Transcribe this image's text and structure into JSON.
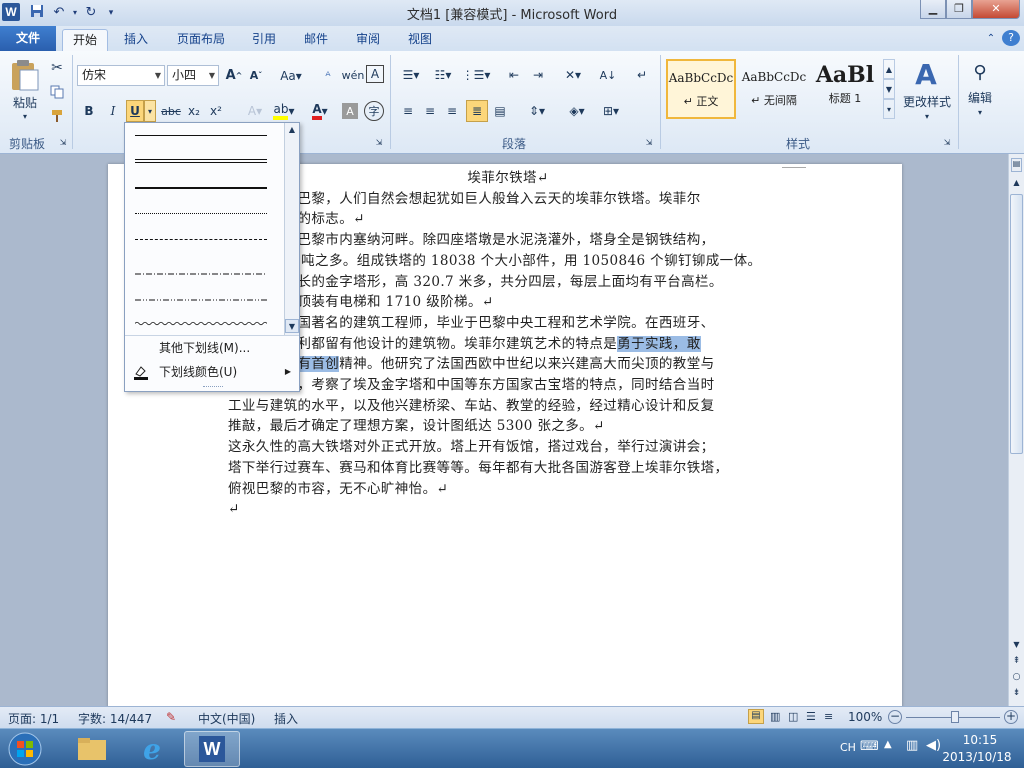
{
  "window": {
    "title": "文档1 [兼容模式] - Microsoft Word",
    "app_logo_letter": "W"
  },
  "ribbon_tabs": [
    "文件",
    "开始",
    "插入",
    "页面布局",
    "引用",
    "邮件",
    "审阅",
    "视图"
  ],
  "clipboard": {
    "paste_label": "粘贴",
    "group_label": "剪贴板"
  },
  "font": {
    "name": "仿宋",
    "size": "小四"
  },
  "paragraph": {
    "group_label": "段落"
  },
  "styles": {
    "group_label": "样式",
    "items": [
      {
        "preview": "AaBbCcDc",
        "name": "↵ 正文"
      },
      {
        "preview": "AaBbCcDc",
        "name": "↵ 无间隔"
      },
      {
        "preview": "AaBl",
        "name": "标题 1"
      }
    ],
    "change_styles_label": "更改样式"
  },
  "editing": {
    "label": "编辑"
  },
  "underline_menu": {
    "more_underlines": "其他下划线(M)...",
    "underline_color": "下划线颜色(U)"
  },
  "document": {
    "heading": "埃菲尔铁塔↵",
    "lines": [
      {
        "pre": "到法国首都巴黎，人们自然会想起犹如巨人般耸入云天的埃菲尔铁塔。埃菲尔",
        "hl": "",
        "post": ""
      },
      {
        "pre": "铁塔是巴黎的标志。↵",
        "hl": "",
        "post": ""
      },
      {
        "pre": "铁塔坐落在巴黎市内塞纳河畔。除四座塔墩是水泥浇灌外，塔身全是钢铁结构，",
        "hl": "",
        "post": ""
      },
      {
        "pre": "重约 9000 吨之多。组成铁塔的 18038 个大小部件，用 1050846 个铆钉铆成一体。",
        "hl": "",
        "post": ""
      },
      {
        "pre": "它是一座细长的金字塔形，高 320.7 米多，共分四层，每层上面均有平台高栏。",
        "hl": "",
        "post": ""
      },
      {
        "pre": "从塔底到塔顶装有电梯和 1710 级阶梯。↵",
        "hl": "",
        "post": ""
      },
      {
        "pre": "埃菲尔是法国著名的建筑工程师，毕业于巴黎中央工程和艺术学院。在西班牙、",
        "hl": "",
        "post": ""
      },
      {
        "pre": "俄国和匈牙利都留有他设计的建筑物。埃菲尔建筑艺术的特点是",
        "hl": "勇于实践，敢",
        "post": ""
      },
      {
        "pre": "",
        "hl": "于革新，富有首创",
        "post": "精神。他研究了法国西欧中世纪以来兴建高大而尖顶的教堂与"
      },
      {
        "pre": "城堡的历史，考察了埃及金字塔和中国等东方国家古宝塔的特点，同时结合当时",
        "hl": "",
        "post": ""
      },
      {
        "pre": "工业与建筑的水平，以及他兴建桥梁、车站、教堂的经验，经过精心设计和反复",
        "hl": "",
        "post": ""
      },
      {
        "pre": "推敲，最后才确定了理想方案，设计图纸达 5300 张之多。↵",
        "hl": "",
        "post": ""
      },
      {
        "pre": "这永久性的高大铁塔对外正式开放。塔上开有饭馆，搭过戏台，举行过演讲会；",
        "hl": "",
        "post": ""
      },
      {
        "pre": "塔下举行过赛车、赛马和体育比赛等等。每年都有大批各国游客登上埃菲尔铁塔，",
        "hl": "",
        "post": ""
      },
      {
        "pre": "俯视巴黎的市容，无不心旷神怡。↵",
        "hl": "",
        "post": ""
      },
      {
        "pre": "↵",
        "hl": "",
        "post": ""
      }
    ]
  },
  "status": {
    "page": "页面: 1/1",
    "words": "字数: 14/447",
    "language": "中文(中国)",
    "mode": "插入",
    "zoom": "100%"
  },
  "taskbar": {
    "ime": "CH",
    "time": "10:15",
    "date": "2013/10/18"
  }
}
